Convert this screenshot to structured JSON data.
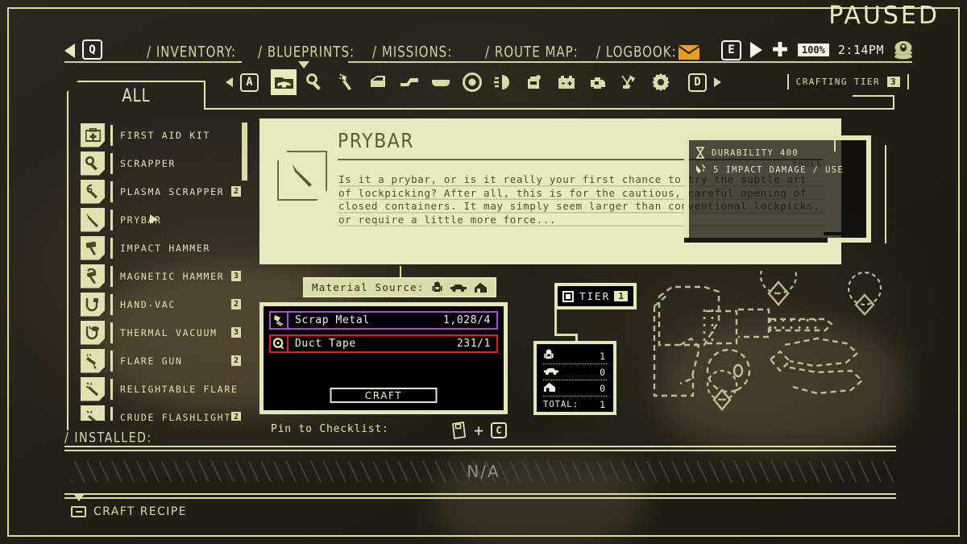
{
  "hud": {
    "paused_label": "PAUSED",
    "prev_key": "Q",
    "next_key": "E",
    "health_pct": "100%",
    "clock": "2:14PM",
    "mail_icon": "envelope-icon",
    "eye_icon": "eye-stack-icon"
  },
  "nav": {
    "items": [
      {
        "label": "/ INVENTORY:"
      },
      {
        "label": "/ BLUEPRINTS:"
      },
      {
        "label": "/ MISSIONS:"
      },
      {
        "label": "/ ROUTE MAP:"
      },
      {
        "label": "/ LOGBOOK:"
      }
    ]
  },
  "categories": {
    "prev_key": "A",
    "next_key": "D",
    "tier_label": "CRAFTING TIER",
    "tier_value": "3",
    "icons": [
      {
        "name": "car-category-icon",
        "selected": true
      },
      {
        "name": "scrapper-category-icon",
        "selected": false
      },
      {
        "name": "spray-category-icon",
        "selected": false
      },
      {
        "name": "door-category-icon",
        "selected": false
      },
      {
        "name": "fender-category-icon",
        "selected": false
      },
      {
        "name": "bumper-category-icon",
        "selected": false
      },
      {
        "name": "wheel-category-icon",
        "selected": false
      },
      {
        "name": "headlight-category-icon",
        "selected": false
      },
      {
        "name": "fueltank-category-icon",
        "selected": false
      },
      {
        "name": "battery-category-icon",
        "selected": false
      },
      {
        "name": "engine-category-icon",
        "selected": false
      },
      {
        "name": "antenna-category-icon",
        "selected": false
      },
      {
        "name": "gear-category-icon",
        "selected": false
      }
    ]
  },
  "tab": {
    "label": "ALL"
  },
  "blueprints": [
    {
      "label": "FIRST AID KIT",
      "count": "",
      "selected": false,
      "icon": "first-aid-kit-icon"
    },
    {
      "label": "SCRAPPER",
      "count": "",
      "selected": false,
      "icon": "scrapper-icon"
    },
    {
      "label": "PLASMA SCRAPPER",
      "count": "2",
      "selected": false,
      "icon": "plasma-scrapper-icon"
    },
    {
      "label": "PRYBAR",
      "count": "",
      "selected": true,
      "icon": "prybar-icon"
    },
    {
      "label": "IMPACT HAMMER",
      "count": "",
      "selected": false,
      "icon": "impact-hammer-icon"
    },
    {
      "label": "MAGNETIC HAMMER",
      "count": "3",
      "selected": false,
      "icon": "magnetic-hammer-icon"
    },
    {
      "label": "HAND-VAC",
      "count": "2",
      "selected": false,
      "icon": "hand-vac-icon"
    },
    {
      "label": "THERMAL VACUUM",
      "count": "3",
      "selected": false,
      "icon": "thermal-vacuum-icon"
    },
    {
      "label": "FLARE GUN",
      "count": "2",
      "selected": false,
      "icon": "flare-gun-icon"
    },
    {
      "label": "RELIGHTABLE FLARE",
      "count": "",
      "selected": false,
      "icon": "relightable-flare-icon"
    },
    {
      "label": "CRUDE FLASHLIGHT",
      "count": "2",
      "selected": false,
      "icon": "crude-flashlight-icon"
    }
  ],
  "detail": {
    "title": "PRYBAR",
    "category": "TOOLS",
    "icon": "prybar-icon",
    "description": "Is it a prybar, or is it really your first chance to try the subtle art of lockpicking? After all, this is for the cautious, careful opening of closed containers. It may simply seem larger than conventional lockpicks, or require a little more force..."
  },
  "stats": [
    {
      "icon": "durability-icon",
      "text": "DURABILITY  400"
    },
    {
      "icon": "impact-damage-icon",
      "text": "5 IMPACT DAMAGE / USE"
    }
  ],
  "material_source": {
    "label": "Material Source:",
    "icons": [
      "backpack-icon",
      "car-icon",
      "home-icon"
    ]
  },
  "materials": [
    {
      "name": "Scrap Metal",
      "qty": "1,028/4",
      "icon": "scrap-metal-icon",
      "border_color": "#b04ad0"
    },
    {
      "name": "Duct Tape",
      "qty": "231/1",
      "icon": "duct-tape-icon",
      "border_color": "#e02020"
    }
  ],
  "craft_button": {
    "label": "CRAFT"
  },
  "tier": {
    "label": "TIER",
    "value": "1"
  },
  "totals": {
    "rows": [
      {
        "icon": "backpack-icon",
        "label": "",
        "value": "1"
      },
      {
        "icon": "car-icon",
        "label": "",
        "value": "0"
      },
      {
        "icon": "home-icon",
        "label": "",
        "value": "0"
      }
    ],
    "total_label": "TOTAL:",
    "total_value": "1"
  },
  "bottom": {
    "installed_label": "/ INSTALLED:",
    "installed_value": "N/A",
    "pin_label": "Pin to Checklist:",
    "pin_key": "C",
    "craft_recipe_label": "CRAFT RECIPE"
  }
}
